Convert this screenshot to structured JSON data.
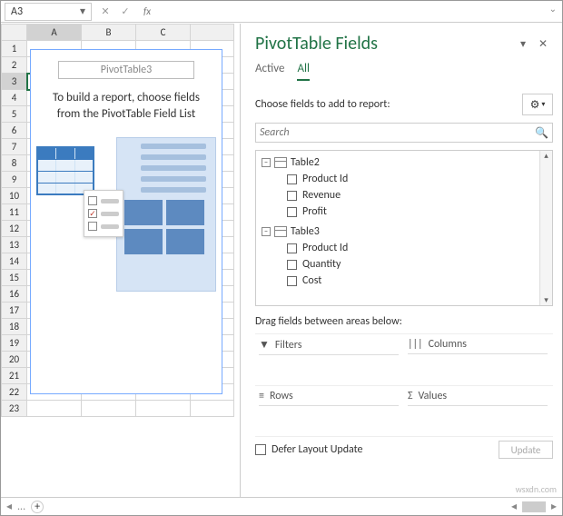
{
  "formula_bar": {
    "name_box": "A3",
    "fx_label": "fx"
  },
  "grid": {
    "columns": [
      "A",
      "B",
      "C"
    ],
    "rows": [
      "1",
      "2",
      "3",
      "4",
      "5",
      "6",
      "7",
      "8",
      "9",
      "10",
      "11",
      "12",
      "13",
      "14",
      "15",
      "16",
      "17",
      "18",
      "19",
      "20",
      "21",
      "22",
      "23"
    ],
    "selected_cell": "A3"
  },
  "pivot_placeholder": {
    "title": "PivotTable3",
    "message": "To build a report, choose fields from the PivotTable Field List"
  },
  "pane": {
    "title": "PivotTable Fields",
    "tabs": {
      "active_label": "Active",
      "all_label": "All",
      "active_index": 1
    },
    "choose_label": "Choose fields to add to report:",
    "search_placeholder": "Search",
    "tables": [
      {
        "name": "Table2",
        "fields": [
          "Product Id",
          "Revenue",
          "Profit"
        ]
      },
      {
        "name": "Table3",
        "fields": [
          "Product Id",
          "Quantity",
          "Cost"
        ]
      }
    ],
    "drag_label": "Drag fields between areas below:",
    "areas": {
      "filters": "Filters",
      "columns": "Columns",
      "rows": "Rows",
      "values": "Values"
    },
    "defer_label": "Defer Layout Update",
    "update_label": "Update"
  },
  "watermark": "wsxdn.com"
}
